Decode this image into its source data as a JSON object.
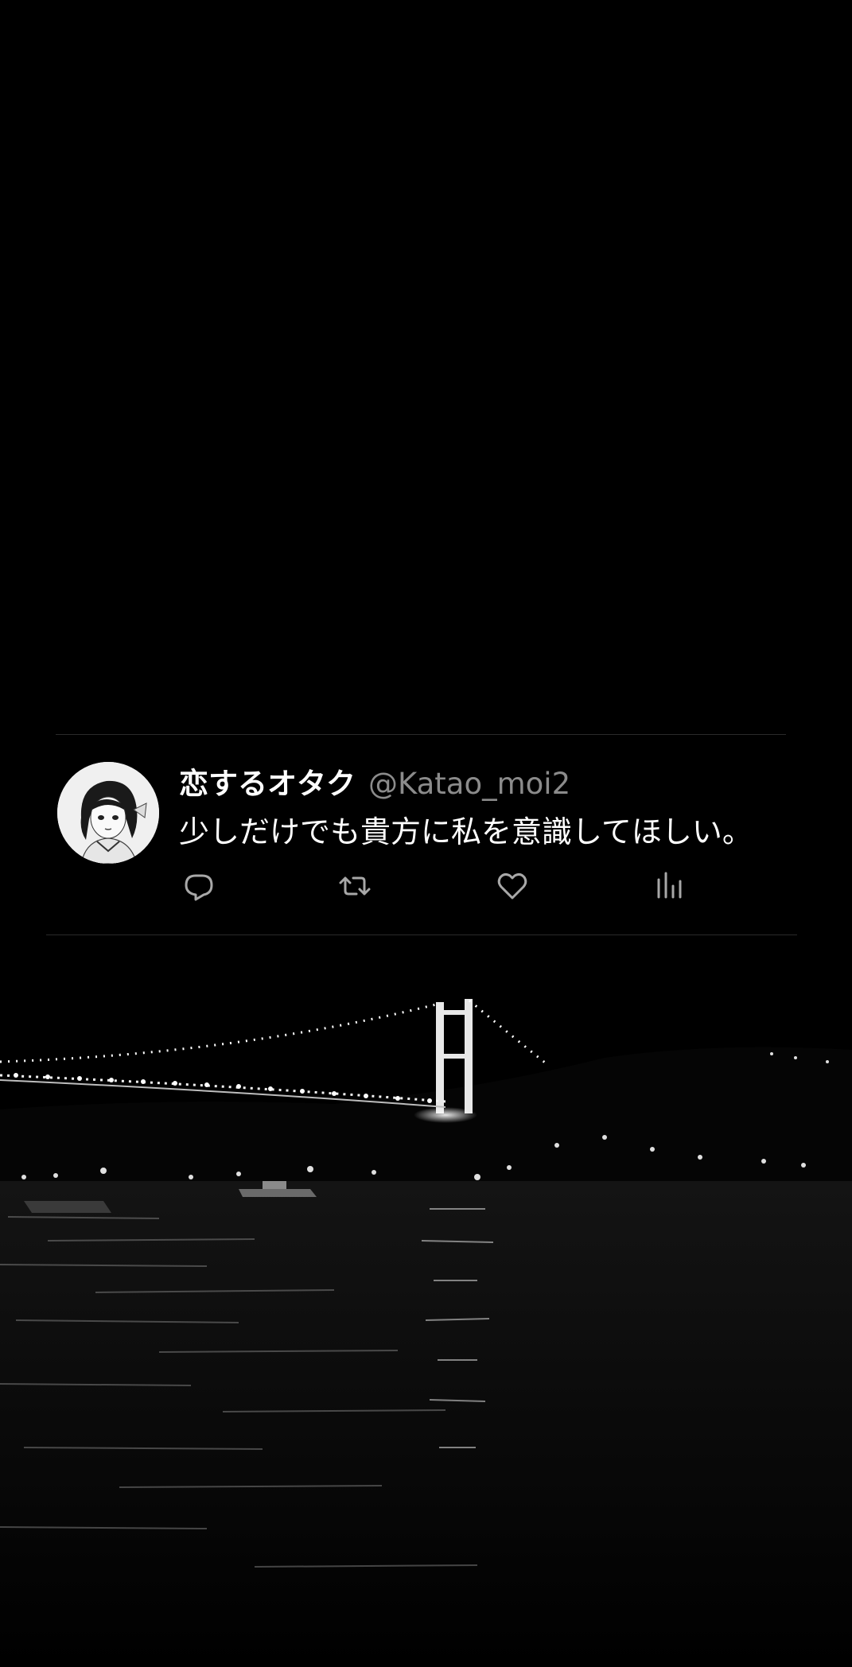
{
  "tweet": {
    "display_name": "恋するオタク",
    "handle": "@Katao_moi2",
    "text": "少しだけでも貴方に私を意識してほしい。"
  },
  "actions": [
    {
      "icon": "reply-icon"
    },
    {
      "icon": "retweet-icon"
    },
    {
      "icon": "like-icon"
    },
    {
      "icon": "analytics-icon"
    }
  ],
  "colors": {
    "background": "#000000",
    "text_primary": "#ffffff",
    "text_secondary": "#8b8b8b",
    "divider": "#2a2a2a"
  }
}
